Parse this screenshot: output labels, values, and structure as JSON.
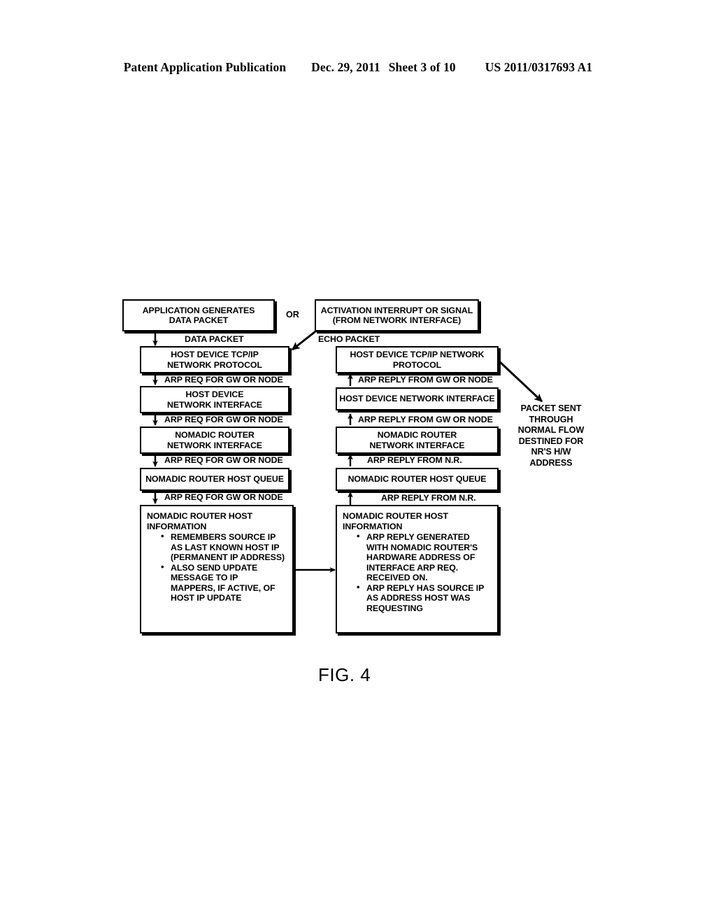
{
  "header": {
    "publication": "Patent Application Publication",
    "date": "Dec. 29, 2011",
    "sheet": "Sheet 3 of 10",
    "patent_number": "US 2011/0317693 A1"
  },
  "figure": {
    "caption": "FIG. 4"
  },
  "diagram": {
    "or_connector": "OR",
    "left_column": {
      "start_box": "APPLICATION GENERATES\nDATA PACKET",
      "edge_start_to_tcpip": "DATA PACKET",
      "tcpip_box": "HOST DEVICE TCP/IP\nNETWORK PROTOCOL",
      "edge_tcpip_to_nic": "ARP REQ FOR GW OR NODE",
      "host_nic_box": "HOST DEVICE\nNETWORK INTERFACE",
      "edge_nic_to_nr_nic": "ARP REQ FOR GW OR NODE",
      "nr_nic_box": "NOMADIC ROUTER\nNETWORK INTERFACE",
      "edge_nr_nic_to_queue": "ARP REQ FOR GW OR NODE",
      "queue_box": "NOMADIC ROUTER HOST QUEUE",
      "edge_queue_to_info": "ARP REQ FOR GW OR NODE",
      "info_box": {
        "title": "NOMADIC ROUTER HOST\nINFORMATION",
        "bullets": [
          "REMEMBERS SOURCE IP\nAS LAST KNOWN HOST IP\n(PERMANENT IP ADDRESS)",
          "ALSO SEND UPDATE\nMESSAGE TO IP\nMAPPERS, IF ACTIVE, OF\nHOST IP UPDATE"
        ]
      }
    },
    "right_column": {
      "start_box": "ACTIVATION INTERRUPT OR SIGNAL\n(FROM NETWORK INTERFACE)",
      "edge_start_to_tcpip": "ECHO PACKET",
      "tcpip_box": "HOST DEVICE TCP/IP NETWORK\nPROTOCOL",
      "edge_tcpip_to_nic": "ARP REPLY FROM GW OR NODE",
      "host_nic_box": "HOST DEVICE NETWORK INTERFACE",
      "edge_nic_to_nr_nic": "ARP REPLY FROM GW OR NODE",
      "nr_nic_box": "NOMADIC ROUTER\nNETWORK INTERFACE",
      "edge_nr_nic_to_queue": "ARP REPLY FROM N.R.",
      "queue_box": "NOMADIC ROUTER HOST QUEUE",
      "edge_queue_to_info": "ARP REPLY FROM N.R.",
      "info_box": {
        "title": "NOMADIC ROUTER HOST\nINFORMATION",
        "bullets": [
          "ARP REPLY GENERATED\nWITH NOMADIC ROUTER'S\nHARDWARE ADDRESS OF\nINTERFACE ARP REQ.\nRECEIVED ON.",
          "ARP REPLY HAS SOURCE IP\nAS ADDRESS HOST WAS\nREQUESTING"
        ]
      }
    },
    "side_annotation": "PACKET SENT\nTHROUGH\nNORMAL FLOW\nDESTINED FOR\nNR'S H/W\nADDRESS"
  }
}
